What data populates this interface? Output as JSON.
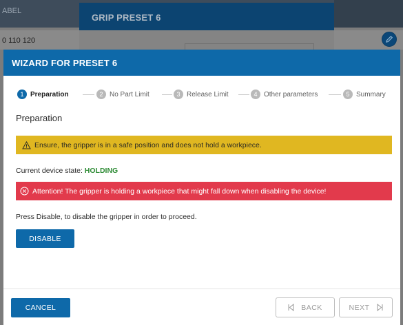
{
  "background": {
    "header_label": "ABEL",
    "row_value": "0 110 120",
    "dialog_title": "GRIP PRESET 6",
    "edit_icon": "pencil-icon"
  },
  "wizard": {
    "title": "WIZARD FOR PRESET 6",
    "steps": [
      {
        "number": "1",
        "label": "Preparation",
        "active": true
      },
      {
        "number": "2",
        "label": "No Part Limit",
        "active": false
      },
      {
        "number": "3",
        "label": "Release Limit",
        "active": false
      },
      {
        "number": "4",
        "label": "Other parameters",
        "active": false
      },
      {
        "number": "5",
        "label": "Summary",
        "active": false
      }
    ],
    "section_title": "Preparation",
    "warning": {
      "icon": "warning-triangle-icon",
      "text": "Ensure, the gripper is in a safe position and does not hold a workpiece."
    },
    "state": {
      "label": "Current device state: ",
      "value": "HOLDING"
    },
    "error": {
      "icon": "error-circle-icon",
      "text": "Attention! The gripper is holding a workpiece that might fall down when disabling the device!"
    },
    "instruction": "Press Disable, to disable the gripper in order to proceed.",
    "disable_label": "DISABLE",
    "footer": {
      "cancel_label": "CANCEL",
      "back_label": "BACK",
      "next_label": "NEXT"
    }
  },
  "colors": {
    "primary": "#0e69a9",
    "warning": "#e0b721",
    "error": "#e23a4c",
    "state_ok": "#2f8c36"
  }
}
